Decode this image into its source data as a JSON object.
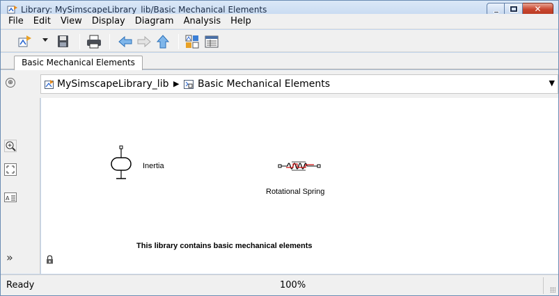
{
  "window": {
    "title": "Library: MySimscapeLibrary_lib/Basic Mechanical Elements",
    "controls": {
      "minimize": "minimize-icon",
      "maximize": "maximize-icon",
      "close": "✕"
    }
  },
  "menubar": {
    "items": [
      {
        "label": "File"
      },
      {
        "label": "Edit"
      },
      {
        "label": "View"
      },
      {
        "label": "Display"
      },
      {
        "label": "Diagram"
      },
      {
        "label": "Analysis"
      },
      {
        "label": "Help"
      }
    ]
  },
  "toolbar": {
    "icons": [
      "new-library-icon",
      "dropdown-arrow-icon",
      "save-icon",
      "print-icon",
      "back-icon",
      "forward-icon",
      "up-icon",
      "library-browser-icon",
      "model-explorer-icon"
    ]
  },
  "tabs": [
    {
      "label": "Basic Mechanical Elements"
    }
  ],
  "address": {
    "crumbs": [
      {
        "label": "MySimscapeLibrary_lib"
      },
      {
        "label": "Basic Mechanical Elements"
      }
    ],
    "separator": "▶",
    "dropdown": "▼"
  },
  "palette": {
    "hide_browser_glyph": "⊕",
    "expand_glyph": "»"
  },
  "canvas": {
    "blocks": [
      {
        "label": "Inertia"
      },
      {
        "label": "Rotational Spring"
      }
    ],
    "annotation": "This library contains basic mechanical elements"
  },
  "statusbar": {
    "status": "Ready",
    "zoom": "100%"
  },
  "colors": {
    "title_bar": "#c3d7f0",
    "close_button": "#c8462f",
    "window_bg": "#f0f0f0",
    "port_red": "#d01010"
  }
}
